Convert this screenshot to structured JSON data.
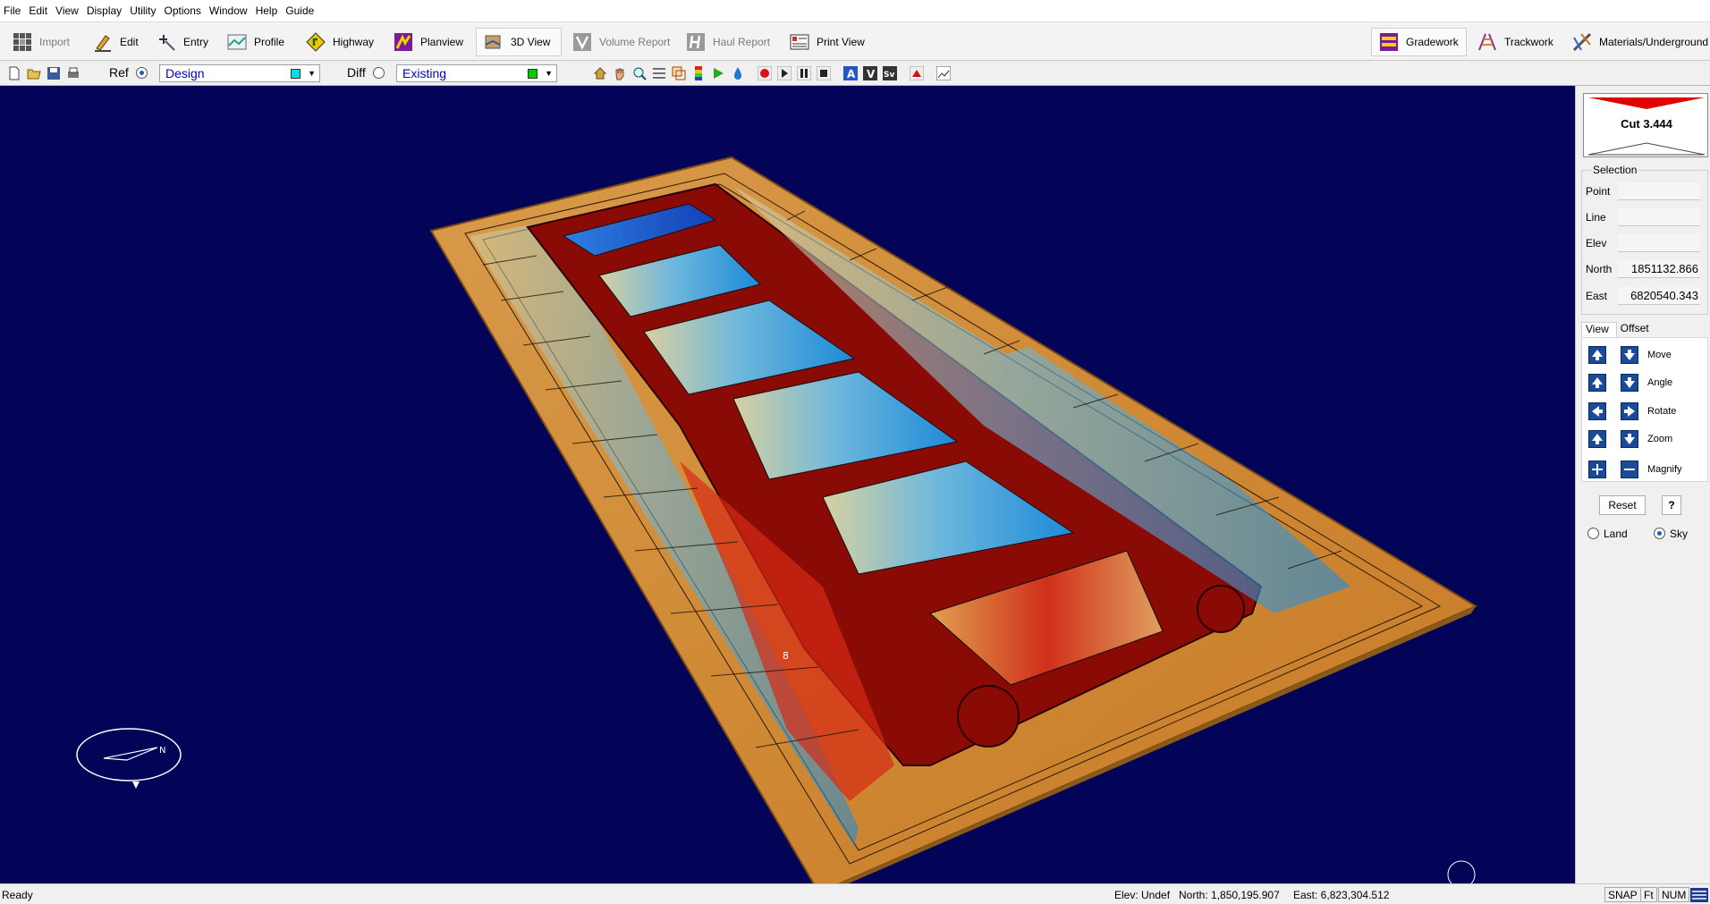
{
  "menu": [
    "File",
    "Edit",
    "View",
    "Display",
    "Utility",
    "Options",
    "Window",
    "Help",
    "Guide"
  ],
  "ribbon": {
    "left": [
      {
        "label": "Import",
        "icon": "grid-icon",
        "disabled": true
      },
      {
        "label": "Edit",
        "icon": "pencil-icon",
        "disabled": false
      },
      {
        "label": "Entry",
        "icon": "entry-icon",
        "disabled": false
      },
      {
        "label": "Profile",
        "icon": "profile-icon",
        "disabled": false
      },
      {
        "label": "Highway",
        "icon": "highway-sign-icon",
        "disabled": false
      },
      {
        "label": "Planview",
        "icon": "planview-icon",
        "disabled": false
      },
      {
        "label": "3D View",
        "icon": "3d-view-icon",
        "disabled": false,
        "active": true
      },
      {
        "label": "Volume Report",
        "icon": "volume-report-icon",
        "disabled": true
      },
      {
        "label": "Haul Report",
        "icon": "haul-report-icon",
        "disabled": true
      },
      {
        "label": "Print View",
        "icon": "print-view-icon",
        "disabled": false
      }
    ],
    "right": [
      {
        "label": "Gradework",
        "icon": "gradework-icon",
        "active": true
      },
      {
        "label": "Trackwork",
        "icon": "trackwork-icon"
      },
      {
        "label": "Materials/Underground",
        "icon": "materials-icon"
      }
    ]
  },
  "toolbar": {
    "ref_label": "Ref",
    "ref_value": "Design",
    "ref_color": "#00e0e0",
    "diff_label": "Diff",
    "diff_value": "Existing",
    "diff_color": "#00cc00"
  },
  "panel": {
    "cut_label": "Cut 3.444",
    "selection_title": "Selection",
    "fields": [
      {
        "label": "Point",
        "value": ""
      },
      {
        "label": "Line",
        "value": ""
      },
      {
        "label": "Elev",
        "value": ""
      },
      {
        "label": "North",
        "value": "1851132.866"
      },
      {
        "label": "East",
        "value": "6820540.343"
      }
    ],
    "tabs": [
      "View",
      "Offset"
    ],
    "controls": [
      "Move",
      "Angle",
      "Rotate",
      "Zoom",
      "Magnify"
    ],
    "reset_label": "Reset",
    "help_label": "?",
    "land_label": "Land",
    "sky_label": "Sky",
    "sky_selected": true
  },
  "viewport": {
    "background": "#030358",
    "cursor_label": "8"
  },
  "status": {
    "ready": "Ready",
    "elev": "Elev: Undef",
    "north": "North: 1,850,195.907",
    "east": "East: 6,823,304.512",
    "snap": "SNAP",
    "units": "Ft",
    "num": "NUM"
  }
}
